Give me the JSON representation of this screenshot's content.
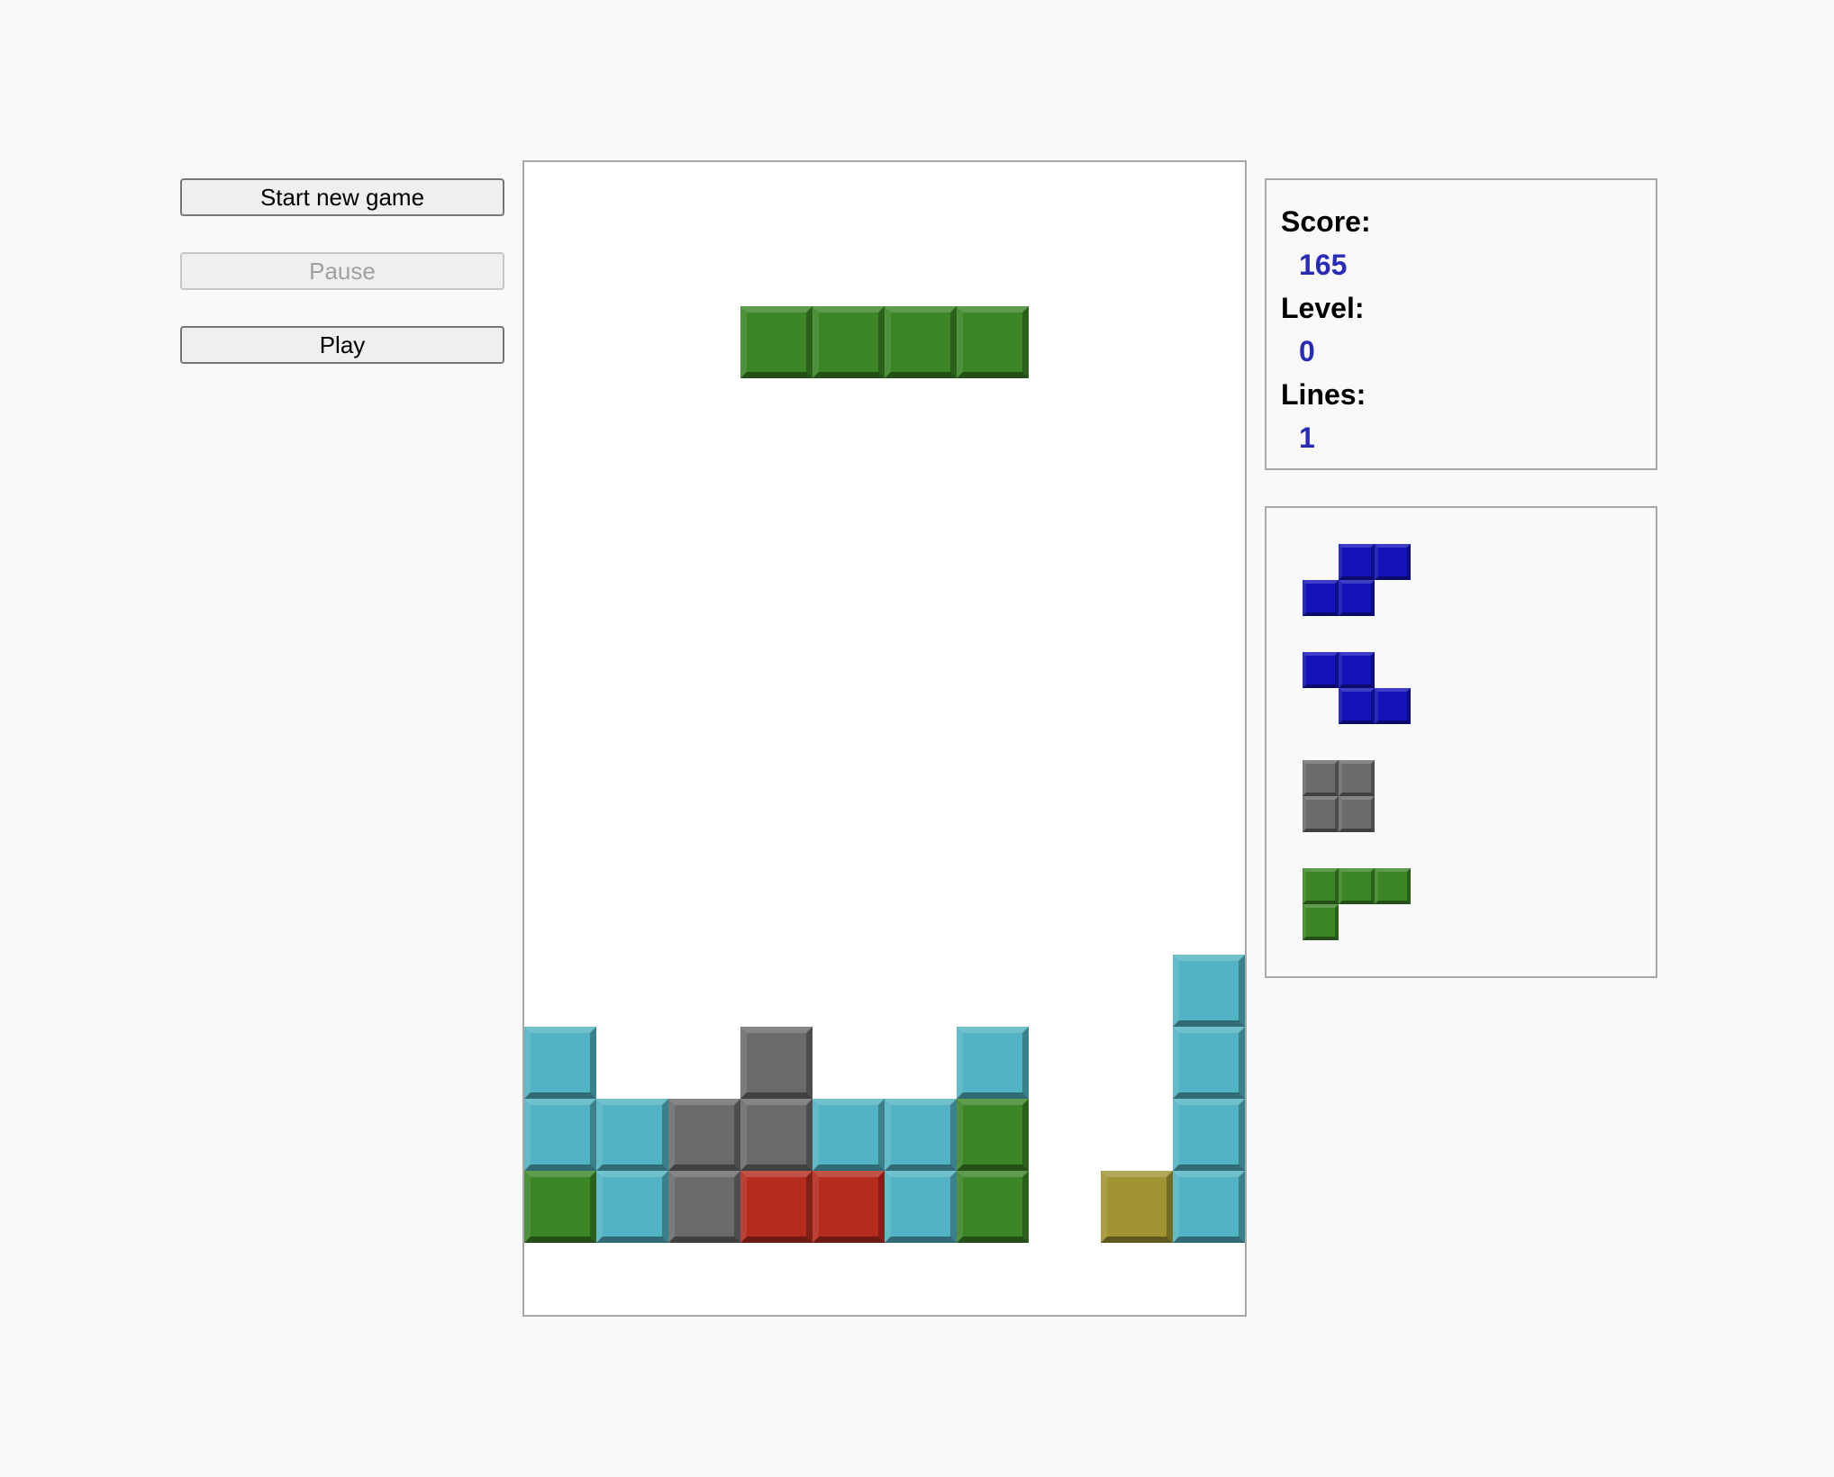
{
  "controls": {
    "start_label": "Start new game",
    "pause_label": "Pause",
    "play_label": "Play"
  },
  "stats": {
    "score_label": "Score:",
    "score_value": "165",
    "level_label": "Level:",
    "level_value": "0",
    "lines_label": "Lines:",
    "lines_value": "1"
  },
  "colors": {
    "G": "#3c8527",
    "C": "#51b3c3",
    "D": "#6b6a6d",
    "R": "#b52b1e",
    "Y": "#a09433",
    "B": "#1212b8",
    "value_text": "#2a2ab8"
  },
  "board": {
    "columns": 10,
    "rows": 16,
    "active_piece": {
      "shape": "I",
      "color": "G",
      "cells": [
        [
          3,
          2
        ],
        [
          4,
          2
        ],
        [
          5,
          2
        ],
        [
          6,
          2
        ]
      ]
    },
    "stack_rows": [
      "..........",
      "..........",
      "..........",
      "..........",
      "..........",
      "..........",
      "..........",
      "..........",
      "..........",
      "..........",
      "..........",
      ".........C",
      "C..D..C..C",
      "CCDDCCG..C",
      "GCDRRCG.YC",
      ".........."
    ]
  },
  "next_pieces": [
    {
      "shape": "S",
      "color": "B",
      "rows": [
        ".XX",
        "XX."
      ]
    },
    {
      "shape": "Z",
      "color": "B",
      "rows": [
        "XX.",
        ".XX"
      ]
    },
    {
      "shape": "O",
      "color": "D",
      "rows": [
        "XX",
        "XX"
      ]
    },
    {
      "shape": "L",
      "color": "G",
      "rows": [
        "XXX",
        "X.."
      ]
    }
  ]
}
